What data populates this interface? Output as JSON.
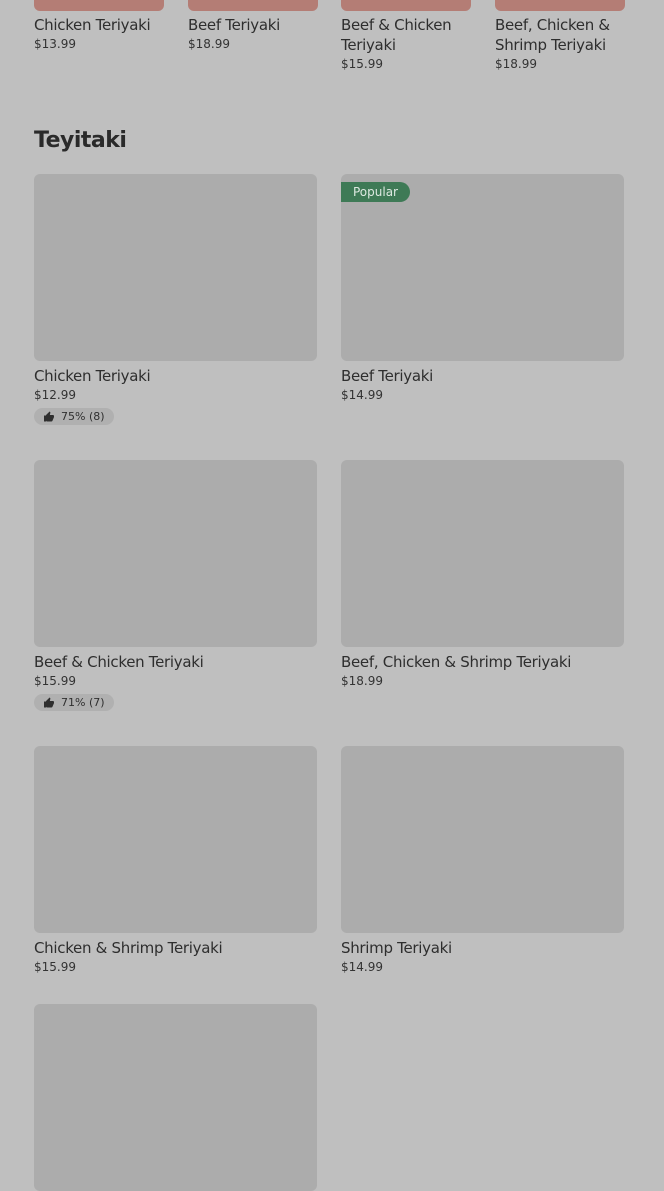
{
  "top_row": [
    {
      "name": "Chicken Teriyaki",
      "price": "$13.99"
    },
    {
      "name": "Beef Teriyaki",
      "price": "$18.99"
    },
    {
      "name": "Beef & Chicken Teriyaki",
      "price": "$15.99"
    },
    {
      "name": "Beef, Chicken & Shrimp Teriyaki",
      "price": "$18.99"
    }
  ],
  "section": {
    "title": "Teyitaki"
  },
  "items": [
    {
      "name": "Chicken Teriyaki",
      "price": "$12.99",
      "rating": "75% (8)"
    },
    {
      "name": "Beef Teriyaki",
      "price": "$14.99",
      "badge": "Popular"
    },
    {
      "name": "Beef & Chicken Teriyaki",
      "price": "$15.99",
      "rating": "71% (7)"
    },
    {
      "name": "Beef, Chicken & Shrimp Teriyaki",
      "price": "$18.99"
    },
    {
      "name": "Chicken & Shrimp Teriyaki",
      "price": "$15.99"
    },
    {
      "name": "Shrimp Teriyaki",
      "price": "$14.99"
    },
    {}
  ],
  "colors": {
    "background": "#bfbfbf",
    "badge": "#3e7a56",
    "image_placeholder": "#acacac",
    "top_thumb": "#b47d75"
  },
  "icons": {
    "rating": "thumbs-up-icon"
  }
}
